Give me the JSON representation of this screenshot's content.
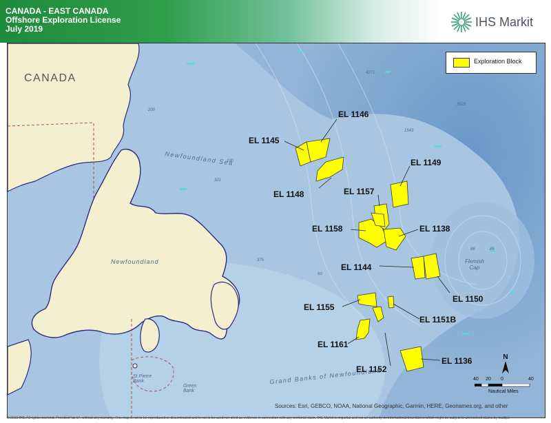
{
  "header": {
    "line1": "CANADA - EAST CANADA",
    "line2": "Offshore Exploration License",
    "line3": "July 2019",
    "logo_text": "IHS Markit",
    "logo_icon": "ihs-markit-starburst-icon"
  },
  "map": {
    "country_label": "CANADA",
    "place_labels": {
      "newfoundland": "Newfoundland",
      "newfoundland_sea": "Newfoundland Sea",
      "grand_banks": "Grand Banks of Newfoundland",
      "flemish_cap": "Flemish Cap",
      "st_pierre_bank": "St Pierre Bank",
      "green_bank": "Green Bank"
    },
    "depth_labels": [
      "4271",
      "3528",
      "1543",
      "190",
      "321",
      "200",
      "375",
      "60",
      "86",
      "86"
    ],
    "blocks": [
      {
        "id": "EL 1145"
      },
      {
        "id": "EL 1146"
      },
      {
        "id": "EL 1148"
      },
      {
        "id": "EL 1149"
      },
      {
        "id": "EL 1157"
      },
      {
        "id": "EL 1158"
      },
      {
        "id": "EL 1138"
      },
      {
        "id": "EL 1144"
      },
      {
        "id": "EL 1150"
      },
      {
        "id": "EL 1155"
      },
      {
        "id": "EL 1151B"
      },
      {
        "id": "EL 1161"
      },
      {
        "id": "EL 1152"
      },
      {
        "id": "EL 1136"
      }
    ],
    "block_color": "#ffff00",
    "legend": {
      "label": "Exploration Block"
    },
    "north_arrow": "N",
    "scale": {
      "ticks": [
        "40",
        "20",
        "0",
        "40"
      ],
      "unit": "Nautical Miles"
    },
    "sources": "Sources: Esri, GEBCO, NOAA, National Geographic, Garmin, HERE, Geonames.org, and other"
  },
  "footer": {
    "disclaimer": "© 2019 IHS. All rights reserved. Provided \"as is\", without any warranty. This map is not to be reproduced or disseminated and is not to be used nor cited as evidence in connection with any territorial claim. IHS Markit is impartial and not an authority on international boundaries which might be subject to unresolved claims by multiple"
  }
}
